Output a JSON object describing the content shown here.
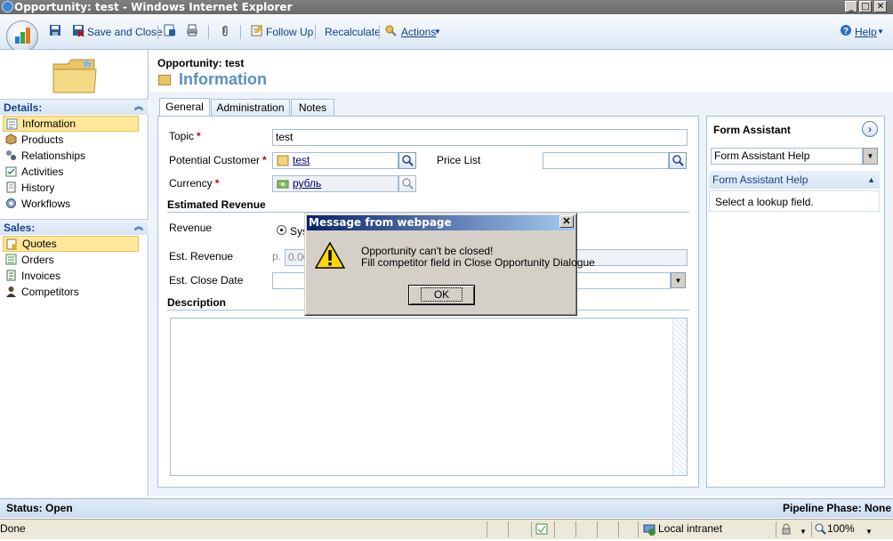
{
  "window": {
    "title": "Opportunity: test - Windows Internet Explorer"
  },
  "toolbar": {
    "save_and_close": "Save and Close",
    "follow_up": "Follow Up",
    "recalculate": "Recalculate",
    "actions": "Actions",
    "help": "Help"
  },
  "sidebar": {
    "details_header": "Details:",
    "details_items": [
      "Information",
      "Products",
      "Relationships",
      "Activities",
      "History",
      "Workflows"
    ],
    "sales_header": "Sales:",
    "sales_items": [
      "Quotes",
      "Orders",
      "Invoices",
      "Competitors"
    ]
  },
  "header": {
    "entity": "Opportunity: test",
    "title": "Information"
  },
  "tabs": [
    "General",
    "Administration",
    "Notes"
  ],
  "form": {
    "topic_label": "Topic",
    "topic_value": "test",
    "customer_label": "Potential Customer",
    "customer_value": "test",
    "pricelist_label": "Price List",
    "currency_label": "Currency",
    "currency_value": "рубль",
    "est_revenue_section": "Estimated Revenue",
    "revenue_label": "Revenue",
    "revenue_option": "Sys",
    "est_revenue_label": "Est. Revenue",
    "est_revenue_prefix": "р.",
    "est_revenue_value": "0.00",
    "est_close_label": "Est. Close Date",
    "description_section": "Description"
  },
  "form_assistant": {
    "title": "Form Assistant",
    "dropdown_value": "Form Assistant Help",
    "panel_header": "Form Assistant Help",
    "panel_text": "Select a lookup field."
  },
  "status": {
    "left": "Status: Open",
    "right": "Pipeline Phase: None"
  },
  "ie_status": {
    "done": "Done",
    "zone": "Local intranet",
    "zoom": "100%"
  },
  "dialog": {
    "title": "Message from webpage",
    "line1": "Opportunity can't be closed!",
    "line2": "Fill competitor field in Close Opportunity Dialogue",
    "ok": "OK"
  },
  "colors": {
    "accent": "#15428b",
    "title_blue": "#5c8fc1",
    "selected": "#ffe79a",
    "dialog_title": "#0a246a"
  }
}
